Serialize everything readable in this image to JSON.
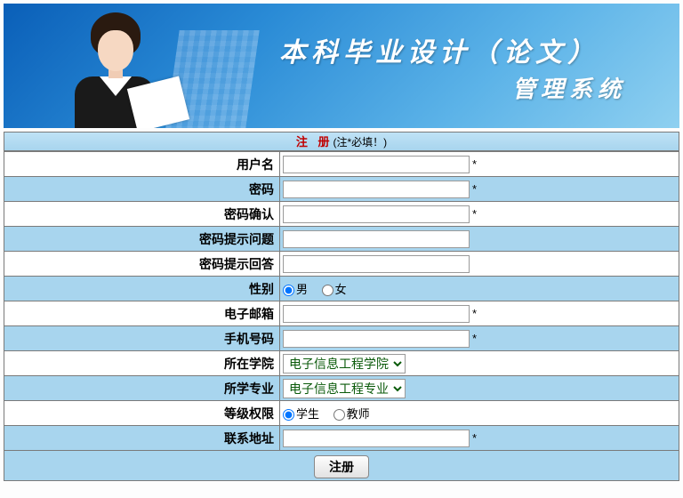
{
  "banner": {
    "title_line1": "本科毕业设计（论文）",
    "title_line2": "管理系统"
  },
  "header": {
    "register": "注 册",
    "hint": "(注*必填！)"
  },
  "labels": {
    "username": "用户名",
    "password": "密码",
    "password_confirm": "密码确认",
    "hint_question": "密码提示问题",
    "hint_answer": "密码提示回答",
    "gender": "性别",
    "email": "电子邮箱",
    "mobile": "手机号码",
    "college": "所在学院",
    "major": "所学专业",
    "role": "等级权限",
    "address": "联系地址"
  },
  "options": {
    "gender_male": "男",
    "gender_female": "女",
    "college_selected": "电子信息工程学院",
    "major_selected": "电子信息工程专业",
    "role_student": "学生",
    "role_teacher": "教师"
  },
  "required_mark": "*",
  "submit_label": "注册"
}
